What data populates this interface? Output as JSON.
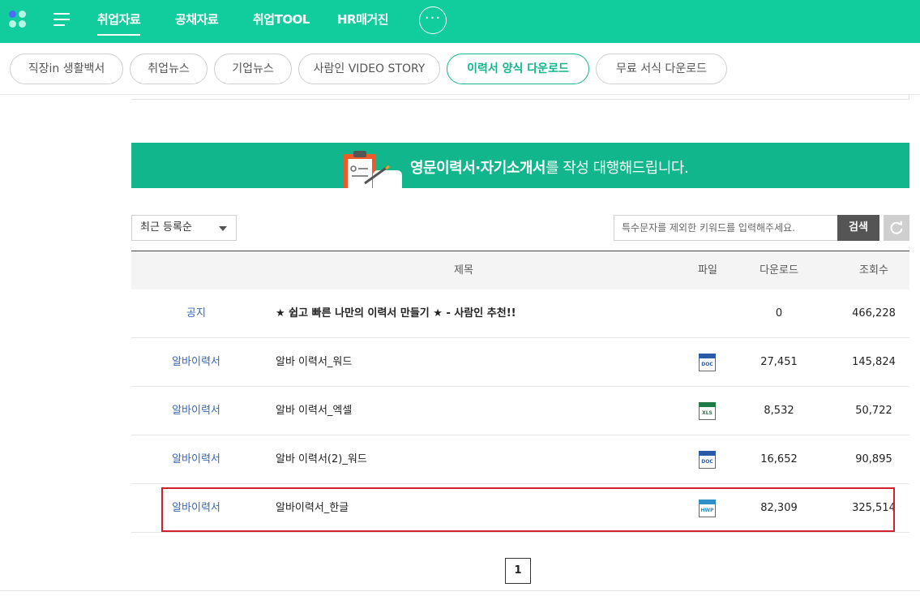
{
  "nav": {
    "items": [
      "취업자료",
      "공채자료",
      "취업TOOL",
      "HR매거진"
    ],
    "more_label": "···"
  },
  "subtabs": [
    "직장in 생활백서",
    "취업뉴스",
    "기업뉴스",
    "사람인 VIDEO STORY",
    "이력서 양식 다운로드",
    "무료 서식 다운로드"
  ],
  "banner": {
    "bold_text": "영문이력서·자기소개서",
    "rest_text": "를 작성 대행해드립니다."
  },
  "filter": {
    "sort_selected": "최근 등록순",
    "search_placeholder": "특수문자를 제외한 키워드를 입력해주세요.",
    "search_button": "검색"
  },
  "table": {
    "headers": {
      "title": "제목",
      "file": "파일",
      "downloads": "다운로드",
      "views": "조회수"
    },
    "rows": [
      {
        "category": "공지",
        "title": "★ 쉽고 빠른 나만의 이력서 만들기 ★ - 사람인 추천!!",
        "file": "",
        "downloads": "0",
        "views": "466,228"
      },
      {
        "category": "알바이력서",
        "title": "알바 이력서_워드",
        "file": "DOC",
        "downloads": "27,451",
        "views": "145,824"
      },
      {
        "category": "알바이력서",
        "title": "알바 이력서_엑셀",
        "file": "XLS",
        "downloads": "8,532",
        "views": "50,722"
      },
      {
        "category": "알바이력서",
        "title": "알바 이력서(2)_워드",
        "file": "DOC",
        "downloads": "16,652",
        "views": "90,895"
      },
      {
        "category": "알바이력서",
        "title": "알바이력서_한글",
        "file": "HWP",
        "downloads": "82,309",
        "views": "325,514"
      }
    ]
  },
  "pagination": {
    "current": "1"
  },
  "colors": {
    "brand": "#11cc9d",
    "banner": "#11b68c",
    "link": "#3867b8",
    "highlight": "#d0202a",
    "doc": "#2b5aa8",
    "xls": "#1e7b45",
    "hwp": "#2f8fc9"
  }
}
